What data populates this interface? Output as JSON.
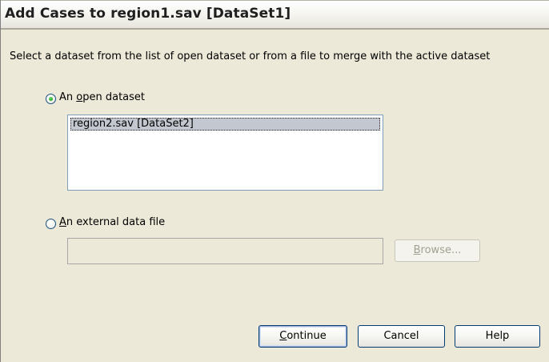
{
  "window": {
    "title": "Add Cases to region1.sav [DataSet1]"
  },
  "instruction": "Select a dataset from the list of open dataset or from a file to merge with the active dataset",
  "open_dataset": {
    "label_prefix": "An ",
    "label_mnemonic": "o",
    "label_suffix": "pen dataset",
    "selected": true,
    "items": [
      "region2.sav [DataSet2]"
    ]
  },
  "external_file": {
    "label_mnemonic": "A",
    "label_suffix": "n external data file",
    "selected": false,
    "value": "",
    "browse_mnemonic": "B",
    "browse_suffix": "rowse..."
  },
  "buttons": {
    "continue_mnemonic": "C",
    "continue_suffix": "ontinue",
    "cancel": "Cancel",
    "help": "Help"
  },
  "colors": {
    "dialog_bg": "#ece9d8",
    "selection_bg": "#c3c7cf",
    "radio_dot": "#21a121",
    "button_border": "#003c74"
  }
}
